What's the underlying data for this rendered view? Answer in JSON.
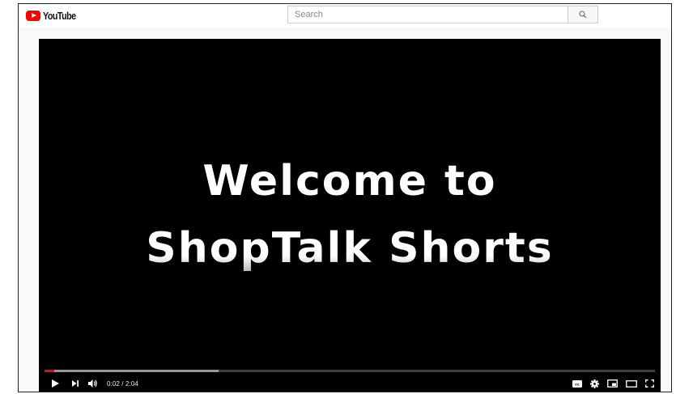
{
  "masthead": {
    "logo_text": "YouTube",
    "search_placeholder": "Search"
  },
  "player": {
    "title_line1": "Welcome to",
    "title_line2": "ShopTalk Shorts",
    "time_current": "0:02",
    "time_separator": " / ",
    "time_duration": "2:04",
    "progress_played_fraction": 0.016,
    "progress_buffered_fraction": 0.285
  },
  "icons": {
    "logo": "youtube-logo-icon",
    "search": "search-icon",
    "play": "play-icon",
    "next": "next-icon",
    "volume": "volume-icon",
    "captions": "captions-icon",
    "settings": "gear-icon",
    "miniplayer": "miniplayer-icon",
    "theater": "theater-mode-icon",
    "fullscreen": "fullscreen-icon"
  },
  "colors": {
    "brand_red": "#ff0000",
    "player_bg": "#000000"
  }
}
